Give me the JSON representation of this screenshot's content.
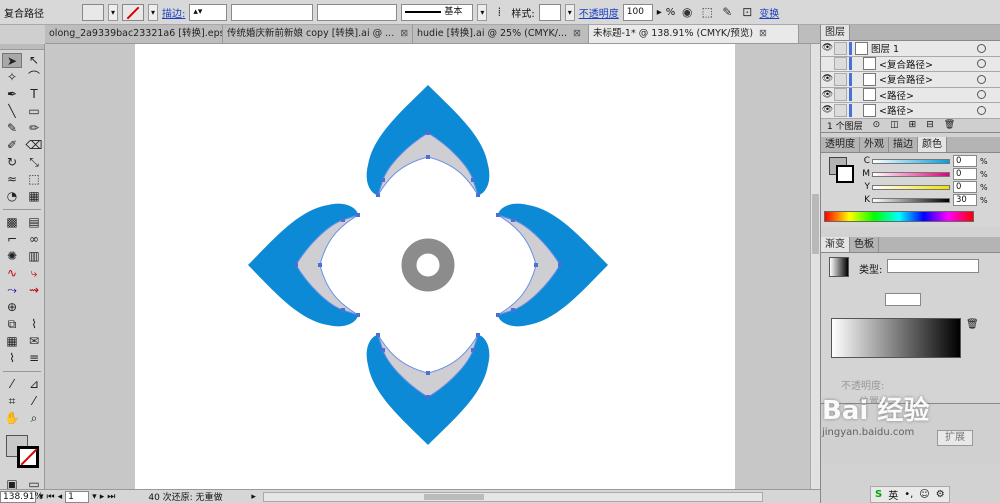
{
  "control_bar": {
    "object_type": "复合路径",
    "stroke_label": "描边:",
    "stroke_profile": "基本",
    "style_label": "样式:",
    "opacity_label": "不透明度",
    "opacity_value": "100",
    "opacity_unit": "%",
    "transform_label": "变换"
  },
  "tabs": [
    {
      "label": "olong_2a9339bac23321a6 [转换].eps*",
      "active": false
    },
    {
      "label": "传统婚庆新前新娘 copy [转换].ai @ ...",
      "active": false
    },
    {
      "label": "hudie [转换].ai @ 25% (CMYK/...",
      "active": false
    },
    {
      "label": "未标题-1* @ 138.91% (CMYK/预览)",
      "active": true
    }
  ],
  "close_glyph": "⊠",
  "status": {
    "zoom": "138.91%",
    "page": "1",
    "undo_text": "40 次还原: 无重做"
  },
  "layers_panel": {
    "tab": "图层",
    "rows": [
      {
        "label": "图层 1",
        "indent": 0,
        "color": "#4a6fd6"
      },
      {
        "label": "<复合路径>",
        "indent": 1,
        "color": "#4a6fd6"
      },
      {
        "label": "<复合路径>",
        "indent": 1,
        "color": "#4a6fd6"
      },
      {
        "label": "<路径>",
        "indent": 1,
        "color": "#4a6fd6"
      },
      {
        "label": "<路径>",
        "indent": 1,
        "color": "#4a6fd6"
      }
    ],
    "count": "1 个图层"
  },
  "color_panel": {
    "tabs": [
      "透明度",
      "外观",
      "描边",
      "颜色"
    ],
    "channels": [
      {
        "ch": "C",
        "value": "0",
        "color": "#00a0e0"
      },
      {
        "ch": "M",
        "value": "0",
        "color": "#e0007a"
      },
      {
        "ch": "Y",
        "value": "0",
        "color": "#f0e000"
      },
      {
        "ch": "K",
        "value": "30",
        "color": "#000000"
      }
    ],
    "unit": "%"
  },
  "gradient_panel": {
    "tabs": [
      "渐变",
      "色板"
    ],
    "type_label": "类型:",
    "opacity_label": "不透明度:",
    "position_label": "位置:"
  },
  "extra_panel": {
    "expand_label": "扩展"
  },
  "watermark": "Bai 经验",
  "watermark_url": "jingyan.baidu.com",
  "taskbar": {
    "ime": "英"
  },
  "artwork": {
    "outer_color": "#0d8ad5",
    "inner_color": "#cfcfd3",
    "center_color": "#8c8c8c"
  }
}
